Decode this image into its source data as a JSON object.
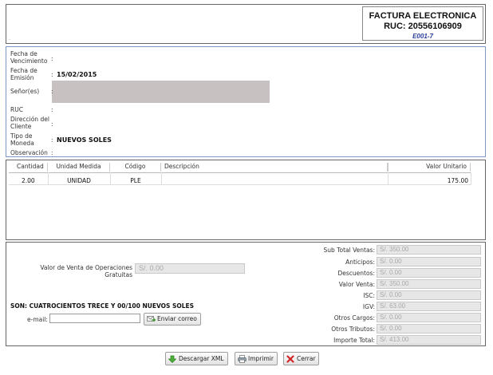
{
  "header": {
    "mark": ".",
    "doc_type": "FACTURA ELECTRONICA",
    "ruc": "RUC: 20556106909",
    "serie": "E001-7"
  },
  "client": {
    "rows": [
      {
        "label": "Fecha de Vencimiento",
        "value": ""
      },
      {
        "label": "Fecha de Emisión",
        "value": "15/02/2015"
      },
      {
        "label": "Señor(es)",
        "value": ""
      },
      {
        "label": "RUC",
        "value": ""
      },
      {
        "label": "Dirección del Cliente",
        "value": ""
      },
      {
        "label": "Tipo de Moneda",
        "value": "NUEVOS SOLES"
      },
      {
        "label": "Observación",
        "value": ""
      }
    ],
    "colon": ":"
  },
  "items": {
    "headers": [
      "Cantidad",
      "Unidad Medida",
      "Código",
      "Descripción",
      "Valor Unitario"
    ],
    "rows": [
      {
        "cantidad": "2.00",
        "unidad": "UNIDAD",
        "codigo": "PLE",
        "descripcion": "",
        "valor": "175.00"
      }
    ]
  },
  "totals": {
    "gratuitas_label": "Valor de Venta de Operaciones Gratuitas",
    "gratuitas_value": "S/. 0.00",
    "amount_words": "SON: CUATROCIENTOS TRECE Y 00/100 NUEVOS SOLES",
    "email_label": "e-mail:",
    "email_value": "",
    "send_button": "Enviar correo",
    "lines": [
      {
        "label": "Sub Total Ventas:",
        "value": "S/. 350.00"
      },
      {
        "label": "Anticipos:",
        "value": "S/. 0.00"
      },
      {
        "label": "Descuentos:",
        "value": "S/. 0.00"
      },
      {
        "label": "Valor Venta:",
        "value": "S/. 350.00"
      },
      {
        "label": "ISC:",
        "value": "S/. 0.00"
      },
      {
        "label": "IGV:",
        "value": "S/. 63.00"
      },
      {
        "label": "Otros Cargos:",
        "value": "S/. 0.00"
      },
      {
        "label": "Otros Tributos:",
        "value": "S/. 0.00"
      },
      {
        "label": "Importe Total:",
        "value": "S/. 413.00"
      }
    ]
  },
  "footer": {
    "download_xml": "Descargar XML",
    "print": "Imprimir",
    "close": "Cerrar"
  },
  "colors": {
    "info_border": "#7a9ac5",
    "serie_text": "#2a3d9a",
    "redaction": "#c7c1c1",
    "readonly_field": "#e7e7e7"
  }
}
